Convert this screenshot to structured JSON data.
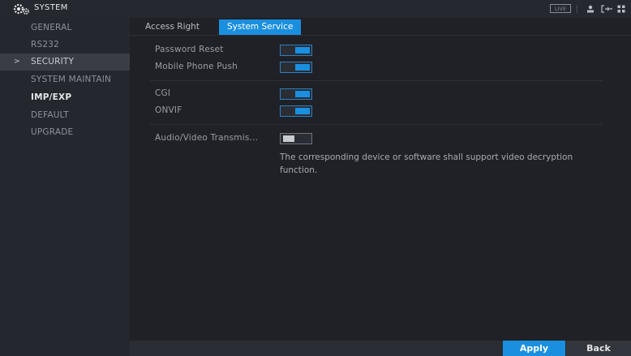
{
  "titlebar": {
    "title": "SYSTEM",
    "live_label": "LIVE",
    "icons": [
      "system-gears-icon",
      "user-icon",
      "logout-icon",
      "grid-menu-icon"
    ]
  },
  "sidebar": {
    "items": [
      {
        "label": "GENERAL"
      },
      {
        "label": "RS232"
      },
      {
        "label": "SECURITY",
        "caret": ">"
      },
      {
        "label": "SYSTEM MAINTAIN"
      },
      {
        "label": "IMP/EXP"
      },
      {
        "label": "DEFAULT"
      },
      {
        "label": "UPGRADE"
      }
    ],
    "active_index": 2
  },
  "tabs": [
    {
      "label": "Access Right"
    },
    {
      "label": "System Service"
    }
  ],
  "services": {
    "password_reset": {
      "label": "Password Reset",
      "enabled": true
    },
    "mobile_push": {
      "label": "Mobile Phone Push",
      "enabled": true
    },
    "cgi": {
      "label": "CGI",
      "enabled": true
    },
    "onvif": {
      "label": "ONVIF",
      "enabled": true
    },
    "av_transmission": {
      "label": "Audio/Video Transmis...",
      "enabled": false
    }
  },
  "note": "The corresponding device or software shall support video decryption function.",
  "buttons": {
    "apply": "Apply",
    "back": "Back"
  },
  "colors": {
    "accent": "#1a8fe0",
    "background": "#1f2126",
    "sidebar": "#24272d"
  }
}
